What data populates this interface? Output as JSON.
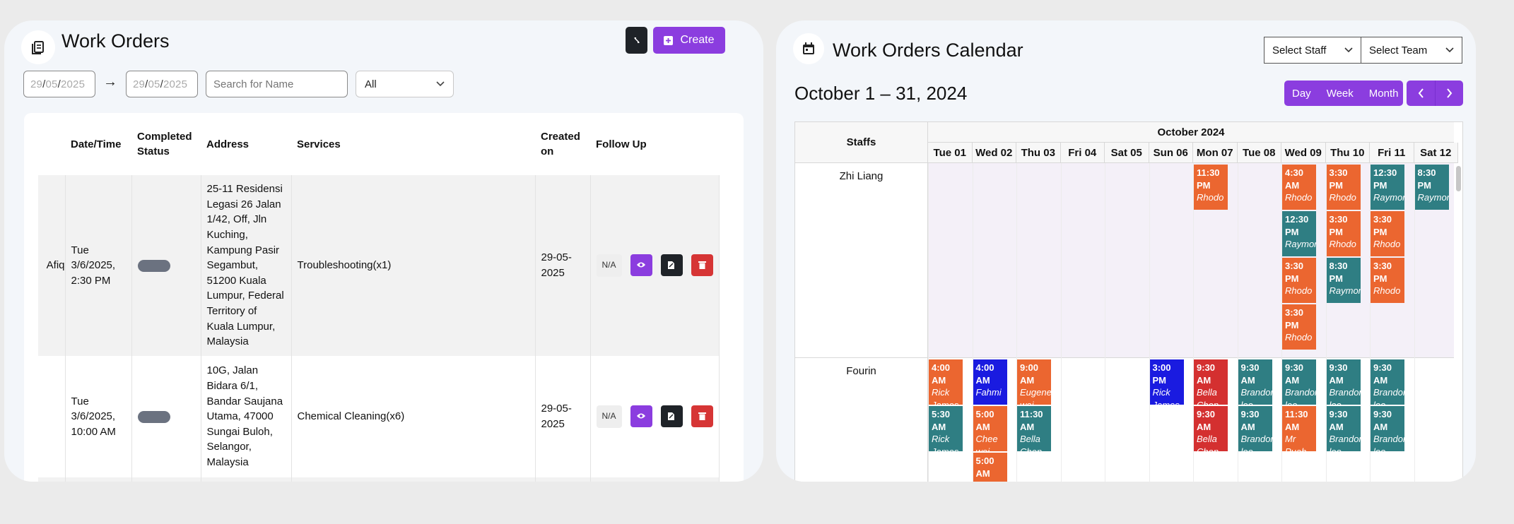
{
  "work_orders": {
    "title": "Work Orders",
    "create_label": "Create",
    "filters": {
      "date_from": {
        "day": "29",
        "month": "05",
        "year": "2025"
      },
      "date_to": {
        "day": "29",
        "month": "05",
        "year": "2025"
      },
      "arrow": "→",
      "search_placeholder": "Search for Name",
      "status_select": "All"
    },
    "columns": [
      "Date/Time",
      "Completed Status",
      "Address",
      "Services",
      "Created on",
      "Follow Up"
    ],
    "rows": [
      {
        "name_fragment": "Afiq",
        "datetime": "Tue 3/6/2025, 2:30 PM",
        "address": "25-11 Residensi Legasi 26 Jalan 1/42, Off, Jln Kuching, Kampung Pasir Segambut, 51200 Kuala Lumpur, Federal Territory of Kuala Lumpur, Malaysia",
        "services": "Troubleshooting(x1)",
        "created_on": "29-05-2025",
        "follow_up": "N/A"
      },
      {
        "name_fragment": "",
        "datetime": "Tue 3/6/2025, 10:00 AM",
        "address": "10G, Jalan Bidara 6/1, Bandar Saujana Utama, 47000 Sungai Buloh, Selangor, Malaysia",
        "services": "Chemical Cleaning(x6)",
        "created_on": "29-05-2025",
        "follow_up": "N/A"
      }
    ]
  },
  "calendar": {
    "title": "Work Orders Calendar",
    "select_staff": "Select Staff",
    "select_team": "Select Team",
    "range_title": "October 1 – 31, 2024",
    "views": [
      "Day",
      "Week",
      "Month"
    ],
    "staffs_header": "Staffs",
    "month_header": "October 2024",
    "days": [
      "Tue 01",
      "Wed 02",
      "Thu 03",
      "Fri 04",
      "Sat 05",
      "Sun 06",
      "Mon 07",
      "Tue 08",
      "Wed 09",
      "Thu 10",
      "Fri 11",
      "Sat 12"
    ],
    "staff": [
      "Zhi Liang",
      "Fourin"
    ],
    "events": [
      {
        "staff": 0,
        "day": 6,
        "slot": 0,
        "color": "orange",
        "time": "11:30 PM",
        "who": "Rhodo"
      },
      {
        "staff": 0,
        "day": 8,
        "slot": 0,
        "color": "orange",
        "time": "4:30 AM",
        "who": "Rhodo"
      },
      {
        "staff": 0,
        "day": 8,
        "slot": 1,
        "color": "teal",
        "time": "12:30 PM",
        "who": "Raymond"
      },
      {
        "staff": 0,
        "day": 8,
        "slot": 2,
        "color": "orange",
        "time": "3:30 PM",
        "who": "Rhodo"
      },
      {
        "staff": 0,
        "day": 8,
        "slot": 3,
        "color": "orange",
        "time": "3:30 PM",
        "who": "Rhodo"
      },
      {
        "staff": 0,
        "day": 9,
        "slot": 0,
        "color": "orange",
        "time": "3:30 PM",
        "who": "Rhodo"
      },
      {
        "staff": 0,
        "day": 9,
        "slot": 1,
        "color": "orange",
        "time": "3:30 PM",
        "who": "Rhodo"
      },
      {
        "staff": 0,
        "day": 9,
        "slot": 2,
        "color": "teal",
        "time": "8:30 PM",
        "who": "Raymond"
      },
      {
        "staff": 0,
        "day": 10,
        "slot": 0,
        "color": "teal",
        "time": "12:30 PM",
        "who": "Raymond"
      },
      {
        "staff": 0,
        "day": 10,
        "slot": 1,
        "color": "orange",
        "time": "3:30 PM",
        "who": "Rhodo"
      },
      {
        "staff": 0,
        "day": 10,
        "slot": 2,
        "color": "orange",
        "time": "3:30 PM",
        "who": "Rhodo"
      },
      {
        "staff": 0,
        "day": 11,
        "slot": 0,
        "color": "teal",
        "time": "8:30 PM",
        "who": "Raymond"
      },
      {
        "staff": 1,
        "day": 0,
        "slot": 0,
        "color": "orange",
        "time": "4:00 AM",
        "who": "Rick James"
      },
      {
        "staff": 1,
        "day": 0,
        "slot": 1,
        "color": "teal",
        "time": "5:30 AM",
        "who": "Rick James"
      },
      {
        "staff": 1,
        "day": 1,
        "slot": 0,
        "color": "blue",
        "time": "4:00 AM",
        "who": "Fahmi"
      },
      {
        "staff": 1,
        "day": 1,
        "slot": 1,
        "color": "orange",
        "time": "5:00 AM",
        "who": "Chee wei"
      },
      {
        "staff": 1,
        "day": 1,
        "slot": 2,
        "color": "orange",
        "time": "5:00 AM",
        "who": ""
      },
      {
        "staff": 1,
        "day": 2,
        "slot": 0,
        "color": "orange",
        "time": "9:00 AM",
        "who": "Eugene wei"
      },
      {
        "staff": 1,
        "day": 2,
        "slot": 1,
        "color": "teal",
        "time": "11:30 AM",
        "who": "Bella Chen"
      },
      {
        "staff": 1,
        "day": 5,
        "slot": 0,
        "color": "blue",
        "time": "3:00 PM",
        "who": "Rick James"
      },
      {
        "staff": 1,
        "day": 6,
        "slot": 0,
        "color": "red",
        "time": "9:30 AM",
        "who": "Bella Chen"
      },
      {
        "staff": 1,
        "day": 6,
        "slot": 1,
        "color": "red",
        "time": "9:30 AM",
        "who": "Bella Chen"
      },
      {
        "staff": 1,
        "day": 7,
        "slot": 0,
        "color": "teal",
        "time": "9:30 AM",
        "who": "Brandon loo"
      },
      {
        "staff": 1,
        "day": 7,
        "slot": 1,
        "color": "teal",
        "time": "9:30 AM",
        "who": "Brandon loo"
      },
      {
        "staff": 1,
        "day": 8,
        "slot": 0,
        "color": "teal",
        "time": "9:30 AM",
        "who": "Brandon loo"
      },
      {
        "staff": 1,
        "day": 8,
        "slot": 1,
        "color": "orange",
        "time": "11:30 AM",
        "who": "Mr Puah"
      },
      {
        "staff": 1,
        "day": 9,
        "slot": 0,
        "color": "teal",
        "time": "9:30 AM",
        "who": "Brandon loo"
      },
      {
        "staff": 1,
        "day": 9,
        "slot": 1,
        "color": "teal",
        "time": "9:30 AM",
        "who": "Brandon loo"
      },
      {
        "staff": 1,
        "day": 10,
        "slot": 0,
        "color": "teal",
        "time": "9:30 AM",
        "who": "Brandon loo"
      },
      {
        "staff": 1,
        "day": 10,
        "slot": 1,
        "color": "teal",
        "time": "9:30 AM",
        "who": "Brandon loo"
      }
    ]
  }
}
